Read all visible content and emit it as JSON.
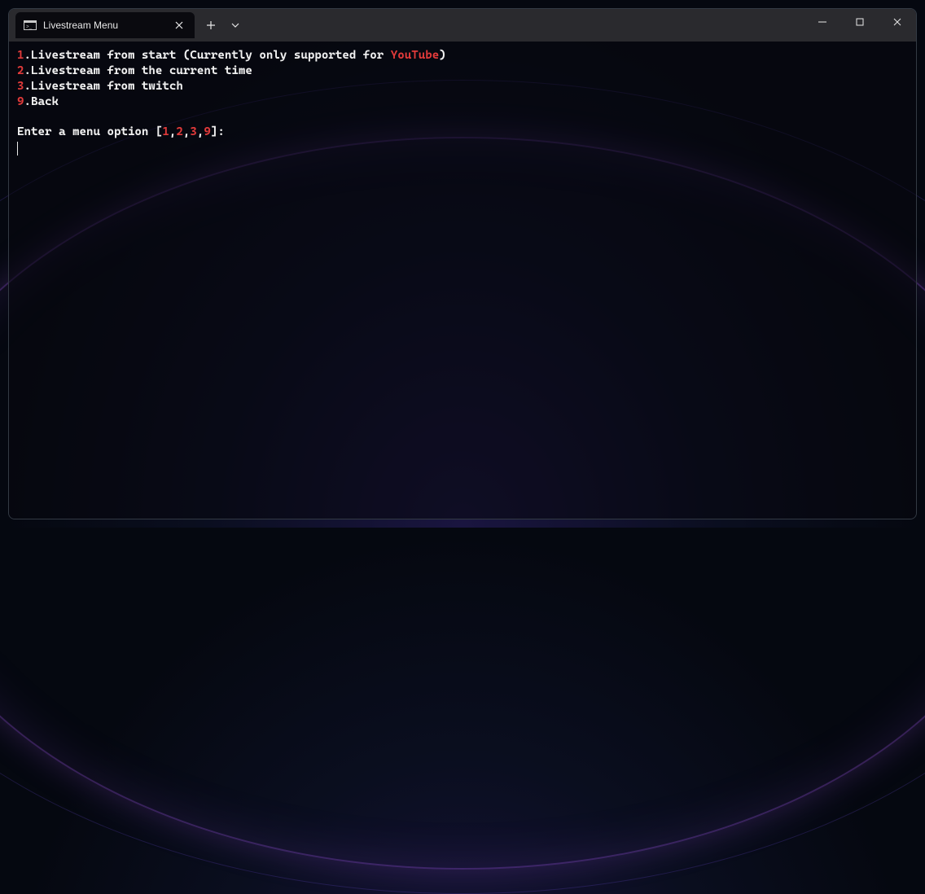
{
  "window": {
    "tab_title": "Livestream Menu"
  },
  "menu": {
    "items": [
      {
        "num": "1",
        "label_prefix": ".Livestream from start (Currently only supported for ",
        "accent": "YouTube",
        "label_suffix": ")"
      },
      {
        "num": "2",
        "label_prefix": ".Livestream from the current time",
        "accent": "",
        "label_suffix": ""
      },
      {
        "num": "3",
        "label_prefix": ".Livestream from twitch",
        "accent": "",
        "label_suffix": ""
      },
      {
        "num": "9",
        "label_prefix": ".Back",
        "accent": "",
        "label_suffix": ""
      }
    ],
    "prompt_prefix": "Enter a menu option [",
    "prompt_options": [
      "1",
      "2",
      "3",
      "9"
    ],
    "prompt_suffix": "]: "
  }
}
